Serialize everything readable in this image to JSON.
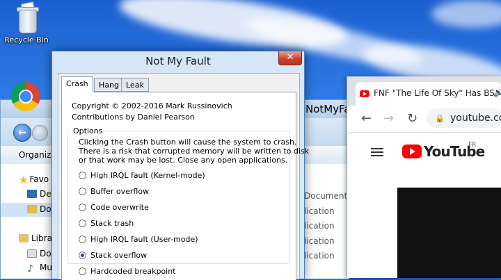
{
  "desktop": {
    "recycle_bin_label": "Recycle Bin"
  },
  "explorer": {
    "title_fragment": "NotMyFa",
    "organize_label": "Organize",
    "nav_items": {
      "favorites": "Favo",
      "desktop": "De",
      "downloads": "Do",
      "libraries": "Libra",
      "documents": "Do",
      "music": "Mu"
    },
    "right_items": [
      "Document",
      "lication",
      "lication",
      "lication",
      "lication"
    ]
  },
  "dialog": {
    "title": "Not My Fault",
    "close_glyph": "✕",
    "tabs": [
      {
        "label": "Crash",
        "active": true
      },
      {
        "label": "Hang",
        "active": false
      },
      {
        "label": "Leak",
        "active": false
      }
    ],
    "copyright": "Copyright © 2002-2016 Mark Russinovich",
    "contributions": "Contributions by Daniel Pearson",
    "options_label": "Options",
    "warning_lines": [
      "Clicking the Crash button will cause the system to crash.",
      "There is a risk that corrupted memory will be written to disk",
      "or that work may be lost. Close any open applications."
    ],
    "options": [
      {
        "label": "High IRQL fault (Kernel-mode)",
        "checked": false
      },
      {
        "label": "Buffer overflow",
        "checked": false
      },
      {
        "label": "Code overwrite",
        "checked": false
      },
      {
        "label": "Stack trash",
        "checked": false
      },
      {
        "label": "High IRQL fault (User-mode)",
        "checked": false
      },
      {
        "label": "Stack overflow",
        "checked": true
      },
      {
        "label": "Hardcoded breakpoint",
        "checked": false
      }
    ]
  },
  "browser": {
    "tab_title": "FNF \"The Life Of Sky\" Has BS",
    "audio_glyph": "🔊",
    "back_glyph": "←",
    "forward_glyph": "→",
    "reload_glyph": "↻",
    "lock_glyph": "🔒",
    "url": "youtube.co",
    "brand_word": "YouTube",
    "region": "FR"
  }
}
